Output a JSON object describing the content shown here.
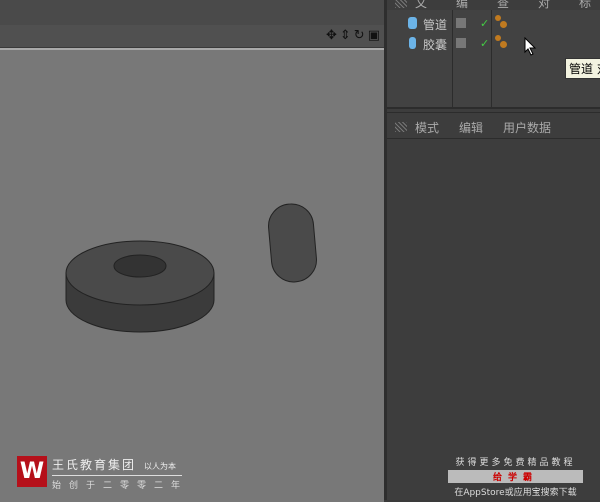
{
  "top_menu": [
    "文件",
    "编辑",
    "查看",
    "对象",
    "标签"
  ],
  "viewport": {
    "icons": [
      "move-icon",
      "pan-down-icon",
      "rotate-icon",
      "maximize-icon"
    ]
  },
  "objects": [
    {
      "name": "管道",
      "icon": "tube-icon"
    },
    {
      "name": "胶囊",
      "icon": "capsule-icon"
    }
  ],
  "tooltip": "管道 对",
  "attr_menu": [
    "模式",
    "编辑",
    "用户数据"
  ],
  "watermark": {
    "brand": "王氏教育集团",
    "slogan": "以人为本",
    "founded": "始创于二零零二年",
    "logo_text": "W"
  },
  "promo": {
    "line1": "获得更多免费精品教程",
    "line2": "给学霸",
    "line3": "在AppStore或应用宝搜索下载"
  },
  "colors": {
    "accent_object": "#6cb4e8",
    "logo_red": "#b5101a",
    "check": "#44cc44"
  }
}
